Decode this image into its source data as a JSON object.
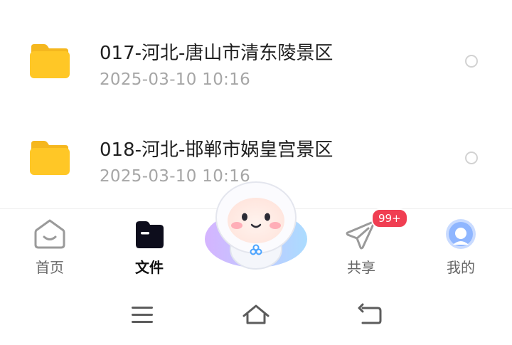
{
  "files": [
    {
      "name": "017-河北-唐山市清东陵景区",
      "time": "2025-03-10  10:16",
      "icon": "folder-icon",
      "selected": false
    },
    {
      "name": "018-河北-邯郸市娲皇宫景区",
      "time": "2025-03-10  10:16",
      "icon": "folder-icon",
      "selected": false
    }
  ],
  "nav": {
    "items": [
      {
        "label": "首页",
        "icon": "home-icon",
        "active": false
      },
      {
        "label": "文件",
        "icon": "file-icon",
        "active": true
      },
      {
        "label": "",
        "icon": "mascot-assistant-icon",
        "active": false
      },
      {
        "label": "共享",
        "icon": "share-send-icon",
        "active": false
      },
      {
        "label": "我的",
        "icon": "profile-avatar-icon",
        "active": false
      }
    ],
    "share_badge": "99+"
  },
  "system_nav": {
    "icons": [
      "menu-icon",
      "home-icon",
      "back-icon"
    ]
  },
  "colors": {
    "folder": "#FFC726",
    "badge": "#F03E52",
    "avatar": "#8FB6FF"
  }
}
